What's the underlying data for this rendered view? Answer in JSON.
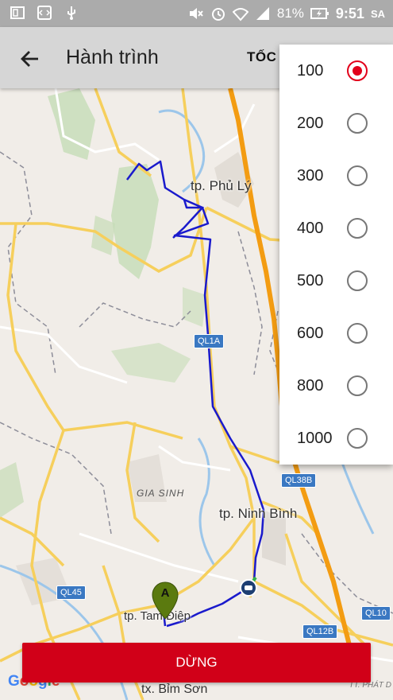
{
  "status_bar": {
    "battery": "81%",
    "time": "9:51",
    "ampm": "SA",
    "icons": [
      "sim-card-icon",
      "developer-code-icon",
      "usb-icon",
      "mute-icon",
      "alarm-icon",
      "wifi-icon",
      "signal-icon",
      "battery-charging-icon"
    ]
  },
  "app_bar": {
    "title": "Hành trình",
    "speed_label": "TỐC",
    "back_icon": "arrow-back-icon"
  },
  "map": {
    "places": {
      "phu_ly": "tp. Phủ Lý",
      "ninh_binh": "tp. Ninh Bình",
      "tam_diep": "tp. Tam Điệp",
      "bim_son": "tx. Bỉm Sơn",
      "gia_sinh": "GIA SINH",
      "tt_phat": "TT. PHÁT D"
    },
    "roads": {
      "ql1a": "QL1A",
      "ql38b": "QL38B",
      "ql45": "QL45",
      "ql10": "QL10",
      "ql12b": "QL12B"
    },
    "marker_label": "A",
    "google": "Google",
    "colors": {
      "route": "#1a1acc",
      "highway": "#f39c12",
      "road": "#f6cf5c",
      "forest": "#c6dcb6"
    }
  },
  "speed_options": [
    {
      "label": "100",
      "selected": true
    },
    {
      "label": "200",
      "selected": false
    },
    {
      "label": "300",
      "selected": false
    },
    {
      "label": "400",
      "selected": false
    },
    {
      "label": "500",
      "selected": false
    },
    {
      "label": "600",
      "selected": false
    },
    {
      "label": "800",
      "selected": false
    },
    {
      "label": "1000",
      "selected": false
    }
  ],
  "stop_button": "DỪNG",
  "accent_color": "#d10018"
}
